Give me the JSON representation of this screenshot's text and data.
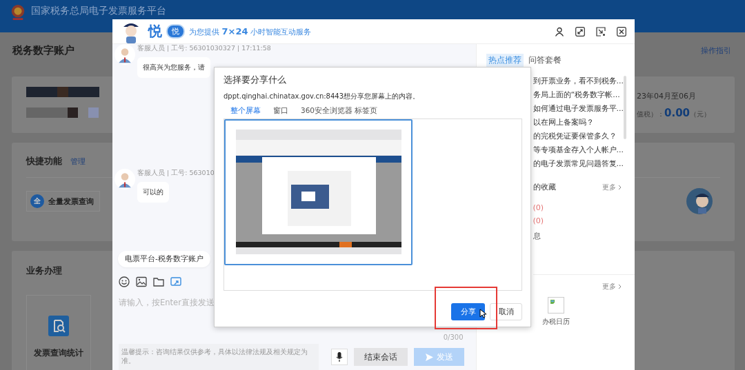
{
  "page": {
    "header_title": "国家税务总局电子发票服务平台",
    "heading": "税务数字账户",
    "guide_link": "操作指引"
  },
  "summary_card": {
    "period": "23年04月至06月",
    "tax_label": "值税）：",
    "amount": "0.00",
    "unit": "（元）"
  },
  "shortcuts": {
    "title": "快捷功能",
    "manage_link": "管理",
    "items": [
      {
        "icon_text": "全",
        "label": "全量发票查询"
      }
    ]
  },
  "business": {
    "title": "业务办理",
    "tiles": [
      {
        "label": "发票查询统计"
      }
    ]
  },
  "chat_window": {
    "brand": "悦",
    "badge_text": "悦",
    "subtitle": "为您提供 **7×24** 小时智能互动服务",
    "messages": [
      {
        "meta": "客服人员 | 工号: 56301030327 | 17:11:58",
        "text": "很高兴为您服务，请"
      },
      {
        "meta": "客服人员 | 工号: 563010",
        "text": "可以的"
      }
    ],
    "quick_chips": [
      "电票平台-税务数字账户"
    ],
    "input": {
      "placeholder": "请输入，按Enter直接发送",
      "counter": "0/300"
    },
    "tip": "温馨提示：咨询结果仅供参考，具体以法律法规及相关规定为准。",
    "end_button": "结束会话",
    "send_button": {
      "label": "发送",
      "disabled": true
    }
  },
  "side_panel": {
    "tabs": [
      {
        "label": "热点推荐",
        "selected": true
      },
      {
        "label": "问答套餐",
        "selected": false
      }
    ],
    "hot_questions": [
      "到开票业务，看不到税务...",
      "务局上面的“税务数字帐...",
      "如何通过电子发票服务平...",
      "以在网上备案吗？",
      "的完税凭证要保管多久？",
      "等专项基金存入个人帐户...",
      "的电子发票常见问题答复..."
    ],
    "favorites": {
      "title": "的收藏",
      "more": "更多",
      "counts": [
        "(0)",
        "(0)"
      ],
      "note": "息"
    },
    "tools": {
      "more": "更多",
      "items": [
        {
          "label": "办税日历"
        }
      ]
    }
  },
  "share_dialog": {
    "title": "选择要分享什么",
    "origin_text": "dppt.qinghai.chinatax.gov.cn:8443想分享您屏幕上的内容。",
    "tabs": [
      {
        "label": "整个屏幕",
        "selected": true
      },
      {
        "label": "窗口",
        "selected": false
      },
      {
        "label": "360安全浏览器 标签页",
        "selected": false
      }
    ],
    "sources": [
      {
        "selected": true
      }
    ],
    "share_button": "分享",
    "cancel_button": "取消"
  }
}
